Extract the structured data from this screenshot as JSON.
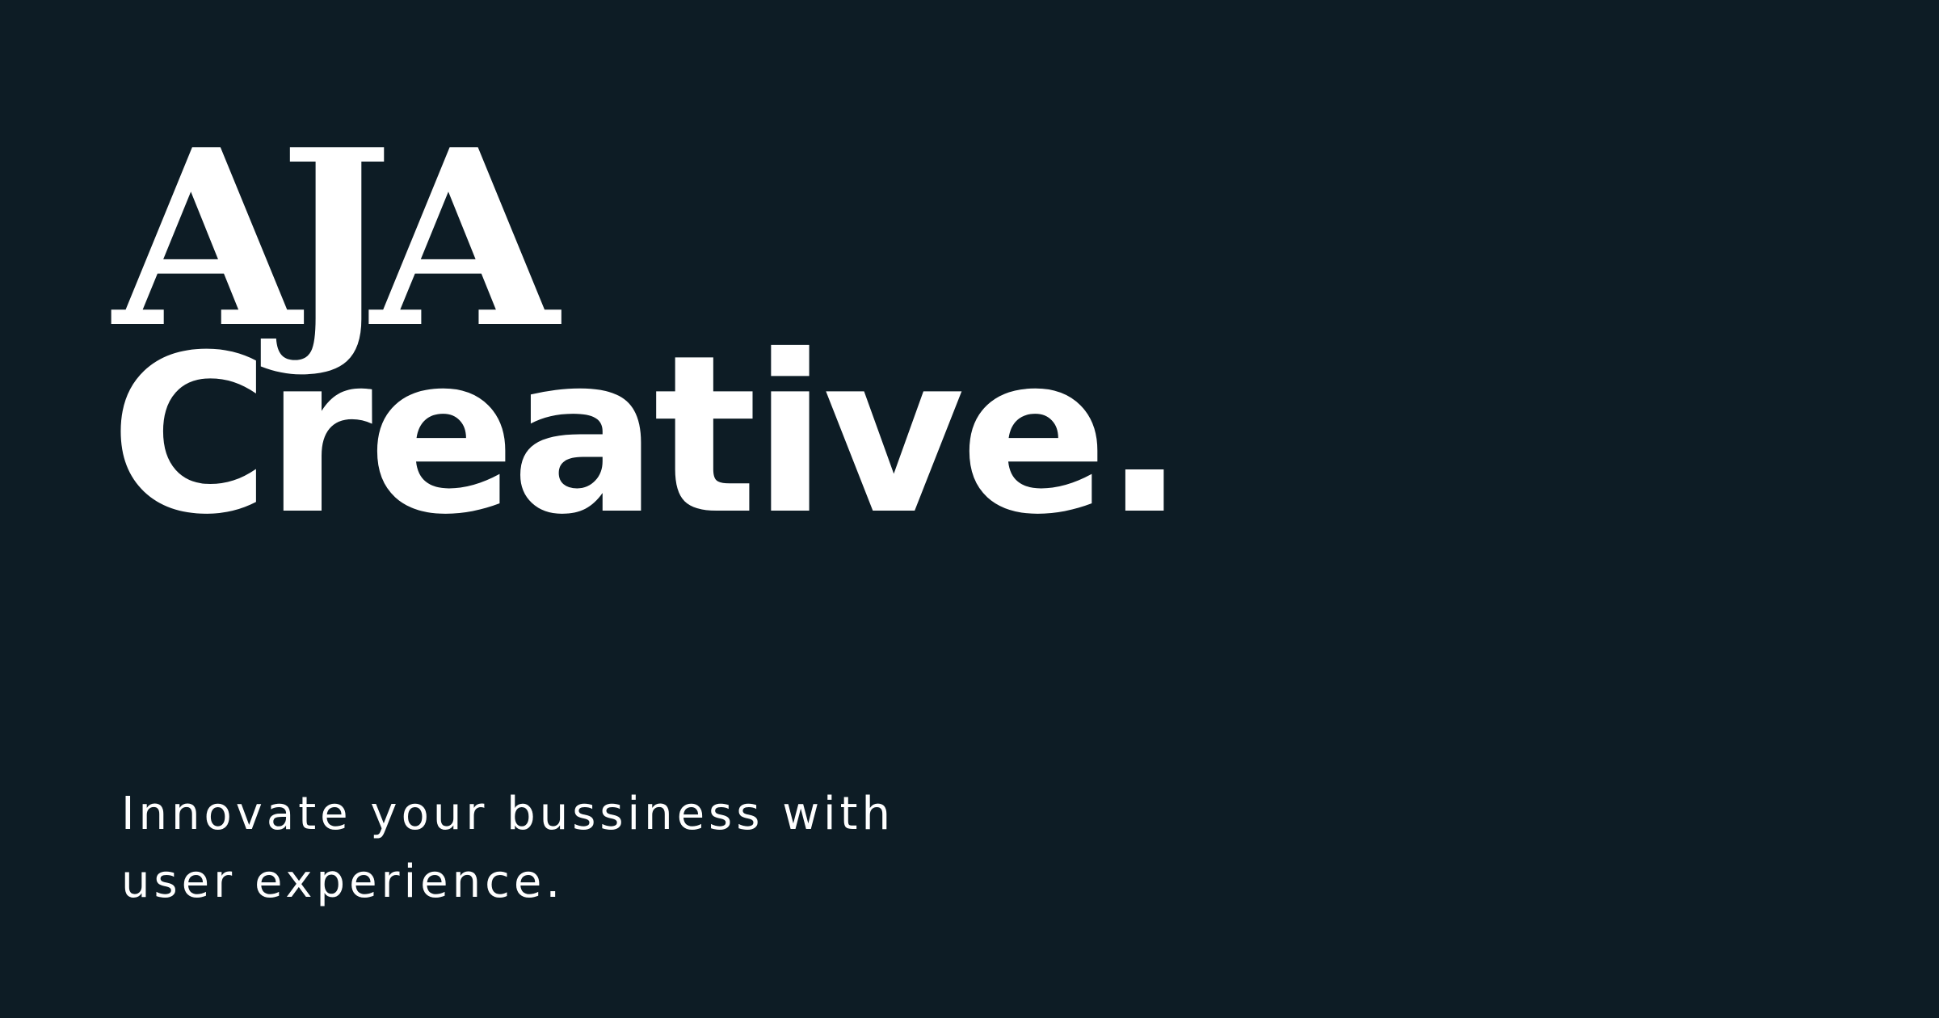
{
  "page": {
    "background_color": "#0d1c25",
    "text_color": "#ffffff"
  },
  "hero": {
    "logo": "AJA",
    "headline": "Creative.",
    "tagline_lines": [
      "Innovate your bussiness with",
      "user experience."
    ]
  }
}
